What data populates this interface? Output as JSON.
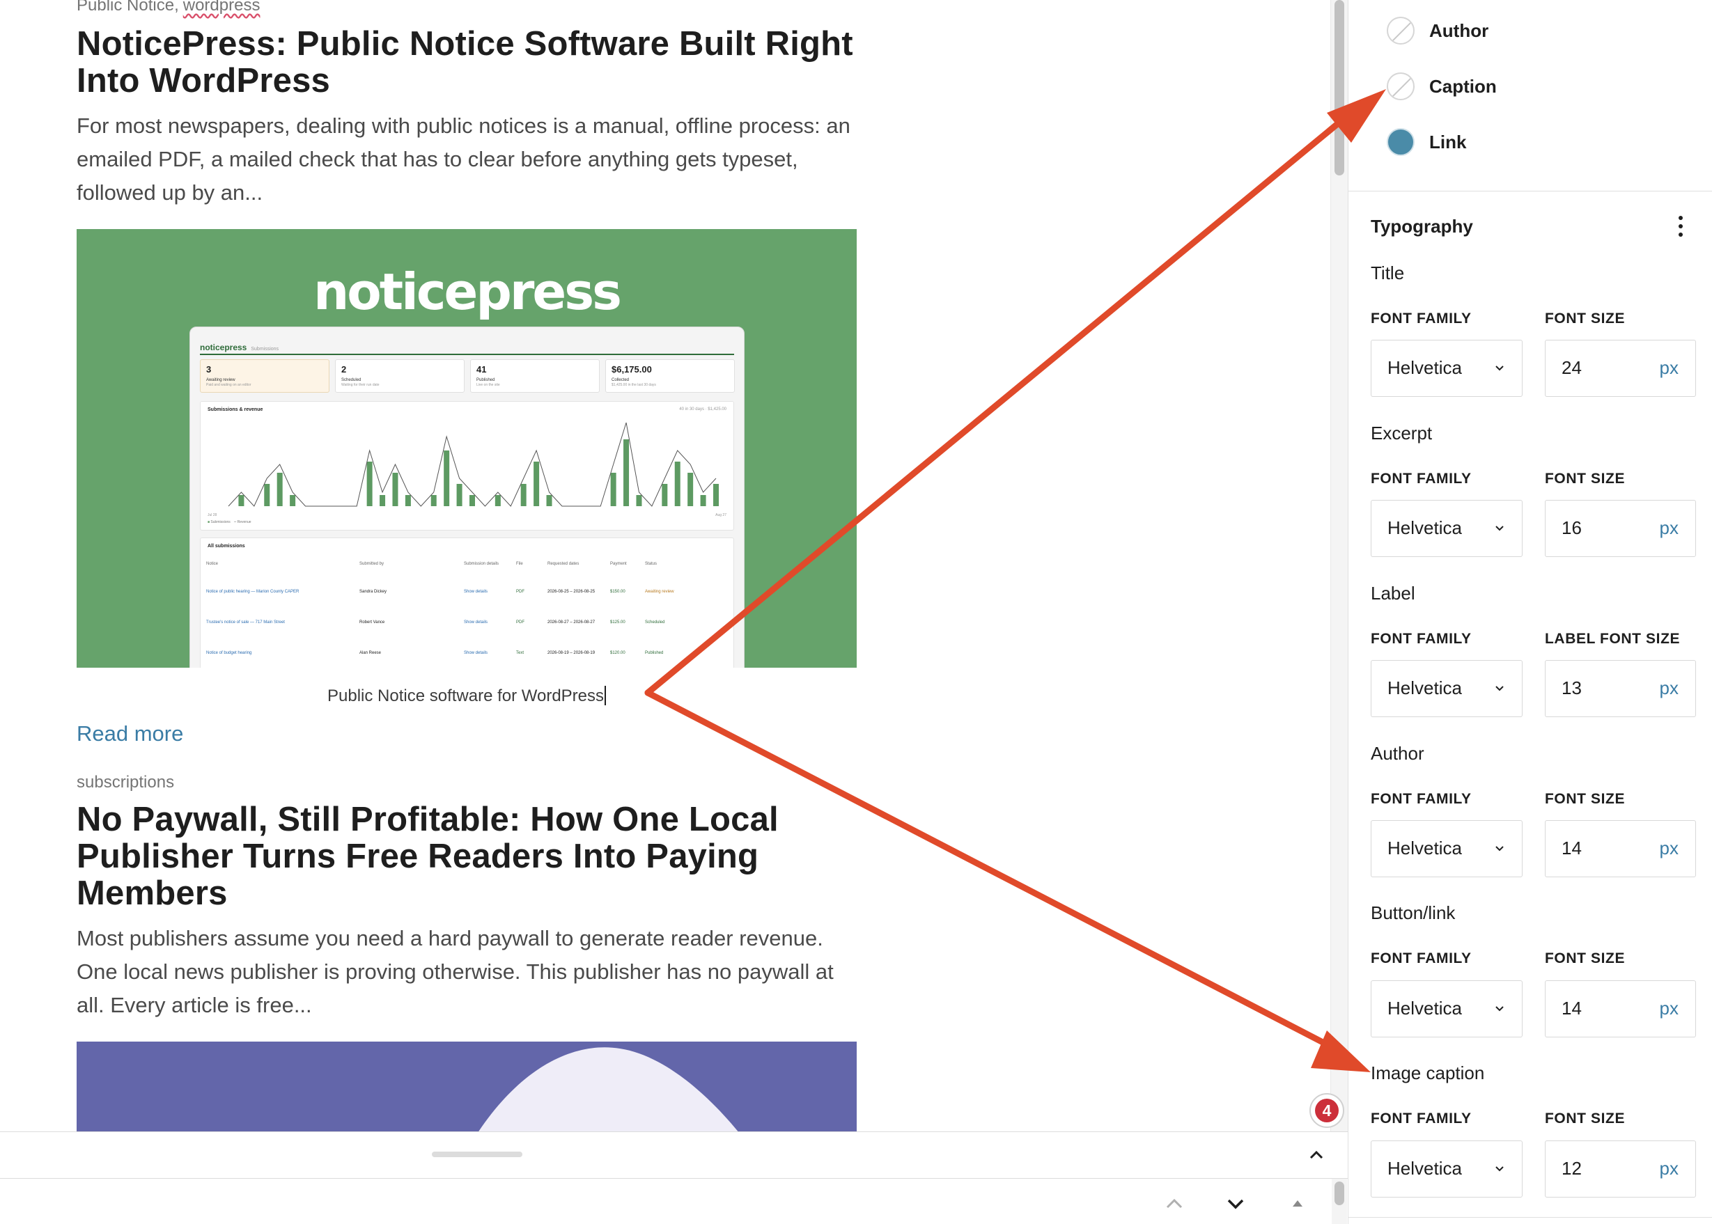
{
  "posts": [
    {
      "categories": [
        "Public Notice",
        "wordpress"
      ],
      "title": "NoticePress: Public Notice Software Built Right Into WordPress",
      "excerpt": "For most newspapers, dealing with public notices is a manual, offline process: an emailed PDF, a mailed check that has to clear before anything gets typeset, followed up by an...",
      "image": {
        "logo_text": "noticepress",
        "background": "#66a36b",
        "dashboard": {
          "brand": "noticepress",
          "brand_sub": "Submissions",
          "stats": [
            {
              "value": "3",
              "label": "Awaiting review",
              "note": "Paid and waiting on an editor"
            },
            {
              "value": "2",
              "label": "Scheduled",
              "note": "Waiting for their run date"
            },
            {
              "value": "41",
              "label": "Published",
              "note": "Live on the site"
            },
            {
              "value": "$6,175.00",
              "label": "Collected",
              "note": "$1,425.00 in the last 30 days"
            }
          ],
          "chart_title": "Submissions & revenue",
          "chart_range": "40 in 30 days · $1,425.00",
          "chart_x_start": "Jul 28",
          "chart_x_end": "Aug 27",
          "chart_legend": [
            "Submissions",
            "Revenue"
          ],
          "chart_values": [
            0,
            1,
            0,
            2,
            3,
            1,
            0,
            0,
            0,
            0,
            0,
            4,
            1,
            3,
            1,
            0,
            1,
            5,
            2,
            1,
            0,
            1,
            0,
            2,
            4,
            1,
            0,
            0,
            0,
            0,
            3,
            6,
            1,
            0,
            2,
            4,
            3,
            1,
            2
          ],
          "table_title": "All submissions",
          "table_headers": [
            "Notice",
            "Submitted by",
            "Submission details",
            "File",
            "Requested dates",
            "Payment",
            "Status"
          ],
          "table_rows": [
            {
              "notice": "Notice of public hearing — Marion County CAPER",
              "by": "Sandra Dickey",
              "details": "Show details",
              "file": "PDF",
              "dates": "2026-08-25 – 2026-08-25",
              "payment": "$150.00",
              "status": "Awaiting review"
            },
            {
              "notice": "Trustee's notice of sale — 717 Main Street",
              "by": "Robert Vance",
              "details": "Show details",
              "file": "PDF",
              "dates": "2026-08-27 – 2026-08-27",
              "payment": "$125.00",
              "status": "Scheduled"
            },
            {
              "notice": "Notice of budget hearing",
              "by": "Alan Reese",
              "details": "Show details",
              "file": "Text",
              "dates": "2026-08-19 – 2026-08-19",
              "payment": "$120.00",
              "status": "Published"
            }
          ]
        }
      },
      "caption": "Public Notice software for WordPress",
      "read_more": "Read more"
    },
    {
      "categories": [
        "subscriptions"
      ],
      "title": "No Paywall, Still Profitable: How One Local Publisher Turns Free Readers Into Paying Members",
      "excerpt": "Most publishers assume you need a hard paywall to generate reader revenue. One local news publisher is proving otherwise. This publisher has no paywall at all. Every article is free...",
      "image": {
        "background": "#6366aa",
        "shape_color": "#efedf8"
      }
    }
  ],
  "notification_count": "4",
  "sidebar": {
    "colors": [
      {
        "label": "Author",
        "swatch": "none"
      },
      {
        "label": "Caption",
        "swatch": "none"
      },
      {
        "label": "Link",
        "swatch": "#4a8ba8"
      }
    ],
    "typography": {
      "title": "Typography",
      "groups": [
        {
          "name": "Title",
          "family_label": "FONT FAMILY",
          "size_label": "FONT SIZE",
          "family": "Helvetica",
          "size": "24",
          "unit": "px"
        },
        {
          "name": "Excerpt",
          "family_label": "FONT FAMILY",
          "size_label": "FONT SIZE",
          "family": "Helvetica",
          "size": "16",
          "unit": "px"
        },
        {
          "name": "Label",
          "family_label": "FONT FAMILY",
          "size_label": "LABEL FONT SIZE",
          "family": "Helvetica",
          "size": "13",
          "unit": "px"
        },
        {
          "name": "Author",
          "family_label": "FONT FAMILY",
          "size_label": "FONT SIZE",
          "family": "Helvetica",
          "size": "14",
          "unit": "px"
        },
        {
          "name": "Button/link",
          "family_label": "FONT FAMILY",
          "size_label": "FONT SIZE",
          "family": "Helvetica",
          "size": "14",
          "unit": "px"
        },
        {
          "name": "Image caption",
          "family_label": "FONT FAMILY",
          "size_label": "FONT SIZE",
          "family": "Helvetica",
          "size": "12",
          "unit": "px"
        }
      ]
    }
  },
  "colors": {
    "accent_link": "#3a7ca5",
    "annotation_arrow": "#e04a2a",
    "badge": "#cc2f3a"
  }
}
